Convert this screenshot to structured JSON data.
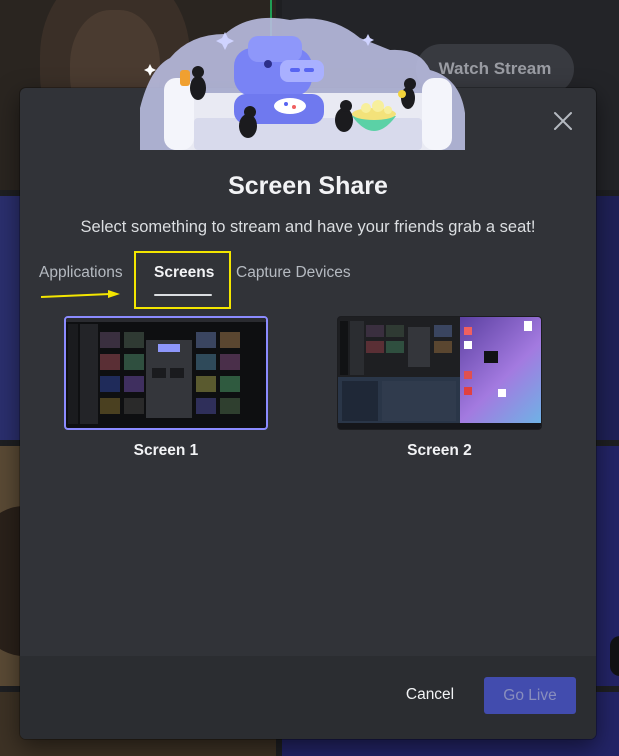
{
  "background": {
    "watch_stream_label": "Watch Stream"
  },
  "modal": {
    "title": "Screen Share",
    "subtitle": "Select something to stream and have your friends grab a seat!",
    "tabs": [
      {
        "label": "Applications",
        "selected": false
      },
      {
        "label": "Screens",
        "selected": true
      },
      {
        "label": "Capture Devices",
        "selected": false
      }
    ],
    "screens": [
      {
        "label": "Screen 1",
        "selected": true
      },
      {
        "label": "Screen 2",
        "selected": false
      }
    ],
    "footer": {
      "cancel_label": "Cancel",
      "go_live_label": "Go Live"
    }
  },
  "icons": {
    "close": "close-icon",
    "mascot": "wumpus-illustration",
    "arrow": "annotation-arrow-icon"
  },
  "colors": {
    "modal_bg": "#313338",
    "footer_bg": "#2b2d31",
    "accent": "#5865f2",
    "selected_border": "#8b8bff",
    "annotation": "#f3e600"
  }
}
